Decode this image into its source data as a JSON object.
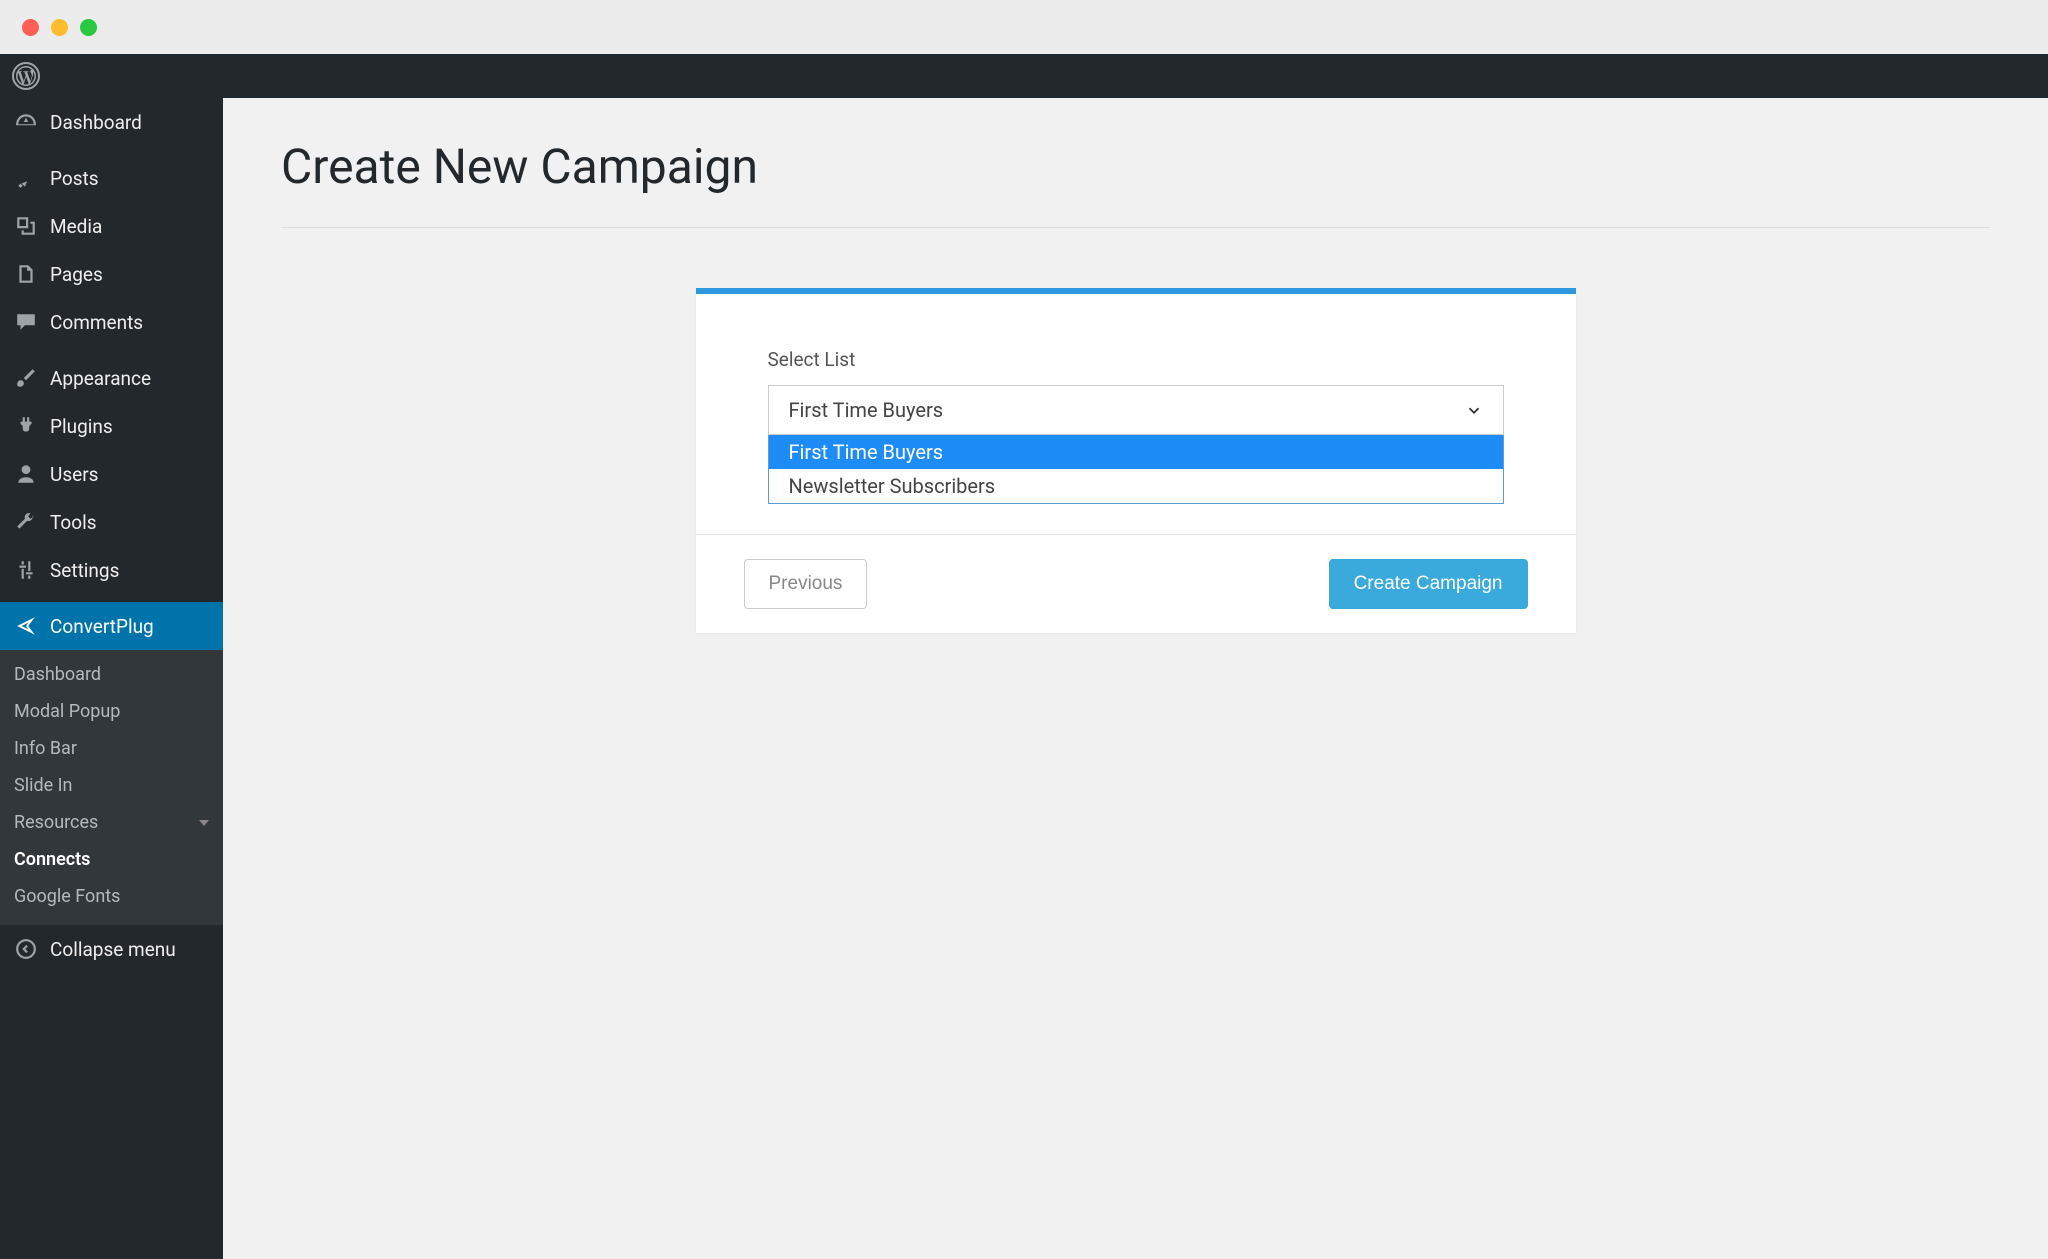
{
  "sidebar": {
    "dashboard": "Dashboard",
    "posts": "Posts",
    "media": "Media",
    "pages": "Pages",
    "comments": "Comments",
    "appearance": "Appearance",
    "plugins": "Plugins",
    "users": "Users",
    "tools": "Tools",
    "settings": "Settings",
    "convertplug": "ConvertPlug",
    "sub": {
      "dashboard": "Dashboard",
      "modal": "Modal Popup",
      "infobar": "Info Bar",
      "slidein": "Slide In",
      "resources": "Resources",
      "connects": "Connects",
      "fonts": "Google Fonts"
    },
    "collapse": "Collapse menu"
  },
  "page": {
    "title": "Create New Campaign"
  },
  "form": {
    "label": "Select List",
    "selected": "First Time Buyers",
    "options": [
      "First Time Buyers",
      "Newsletter Subscribers"
    ]
  },
  "buttons": {
    "previous": "Previous",
    "create": "Create Campaign"
  }
}
